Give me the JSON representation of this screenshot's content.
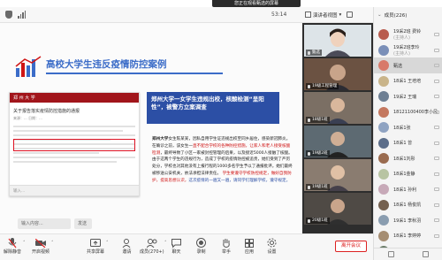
{
  "notice": "您正在观看甄选的屏幕",
  "timer": "53:14",
  "view_label": "演讲者视图",
  "slide": {
    "title": "高校大学生违反疫情防控案例",
    "doc_header": "郑 州 大 学",
    "doc_title": "关于报告落实疫情防控措施的通报",
    "doc_sub": "来源：... 日期：...",
    "doc_footer": "输入...",
    "callout": "郑州大学一女学生违规出校，核酸检测“呈阳性”，被警方立案调查",
    "body_intro": "郑州大学",
    "body_mid": "女生陈某某，因私自用学生证违规出校至同乡居住，感染新冠肺炎。在确诊之前，该女生一",
    "body_red1": "直不配合学校的各种防控措施，让家人和老人接受核酸检测",
    "body_mid2": "，最终导致了小区一家被封控管理的后果，以及接近5000人接触了核酸。",
    "body_end": "由于这两个学生的违规行为，造成了学校的疫情防控被追责，她们受到了严厉处分，学校也对其他没有上报行程的1000多名学生予以了通报批评。她们最终被移送公安机关，依法承担法律责任。",
    "body_red2": "学生要遵守学校防控规定，做好自我防护，提高思想认识，",
    "body_blue": "这次疫情的一遍又一遍，请同学们理解学校，遵守规定。"
  },
  "share_chips": [
    "输入内容...",
    "发送"
  ],
  "toolbar": [
    {
      "label": "解除静音",
      "icon": "mic-muted-icon"
    },
    {
      "label": "开启视频",
      "icon": "camera-off-icon"
    },
    {
      "label": "共享屏幕",
      "icon": "share-screen-icon"
    },
    {
      "label": "邀请",
      "icon": "invite-icon"
    },
    {
      "label": "成员(270+)",
      "icon": "members-icon"
    },
    {
      "label": "聊天",
      "icon": "chat-icon"
    },
    {
      "label": "录制",
      "icon": "record-icon"
    },
    {
      "label": "举手",
      "icon": "raise-hand-icon"
    },
    {
      "label": "应用",
      "icon": "apps-icon"
    },
    {
      "label": "设置",
      "icon": "settings-icon"
    }
  ],
  "leave_label": "离开会议",
  "videos": [
    {
      "name": "甄选"
    },
    {
      "name": "19级工程管理"
    },
    {
      "name": "18级1班"
    },
    {
      "name": "19级2班"
    },
    {
      "name": "19级1班"
    },
    {
      "name": "20级1班"
    }
  ],
  "members_title": "成员(226)",
  "members": [
    {
      "name": "19采2班 费铃",
      "sub": "(主持人)",
      "color": "#b85c4e"
    },
    {
      "name": "19采2班李玲",
      "sub": "(主持人)",
      "color": "#7a8fb8"
    },
    {
      "name": "甄选",
      "sub": "",
      "color": "#d87a6a"
    },
    {
      "name": "18采1 王培培",
      "sub": "",
      "color": "#c9b48a"
    },
    {
      "name": "19采2 王瑞",
      "sub": "",
      "color": "#6e7f93"
    },
    {
      "name": "18121100400李小风",
      "sub": "",
      "color": "#c4785f"
    },
    {
      "name": "18采1张",
      "sub": "",
      "color": "#8fa3c2"
    },
    {
      "name": "18采1 曾",
      "sub": "",
      "color": "#5c6e8a"
    },
    {
      "name": "18采1刘彤",
      "sub": "",
      "color": "#9a6b4f"
    },
    {
      "name": "18采1金静",
      "sub": "",
      "color": "#b8c4a2"
    },
    {
      "name": "18采1 孙利",
      "sub": "",
      "color": "#c7a9b8"
    },
    {
      "name": "18采1 杨俊凯",
      "sub": "",
      "color": "#74604f"
    },
    {
      "name": "19采1 李秋羽",
      "sub": "",
      "color": "#8a9db0"
    },
    {
      "name": "18采1 李婷婷",
      "sub": "",
      "color": "#a58d72"
    },
    {
      "name": "18采1下晨",
      "sub": "",
      "color": "#6b7d6a"
    }
  ]
}
